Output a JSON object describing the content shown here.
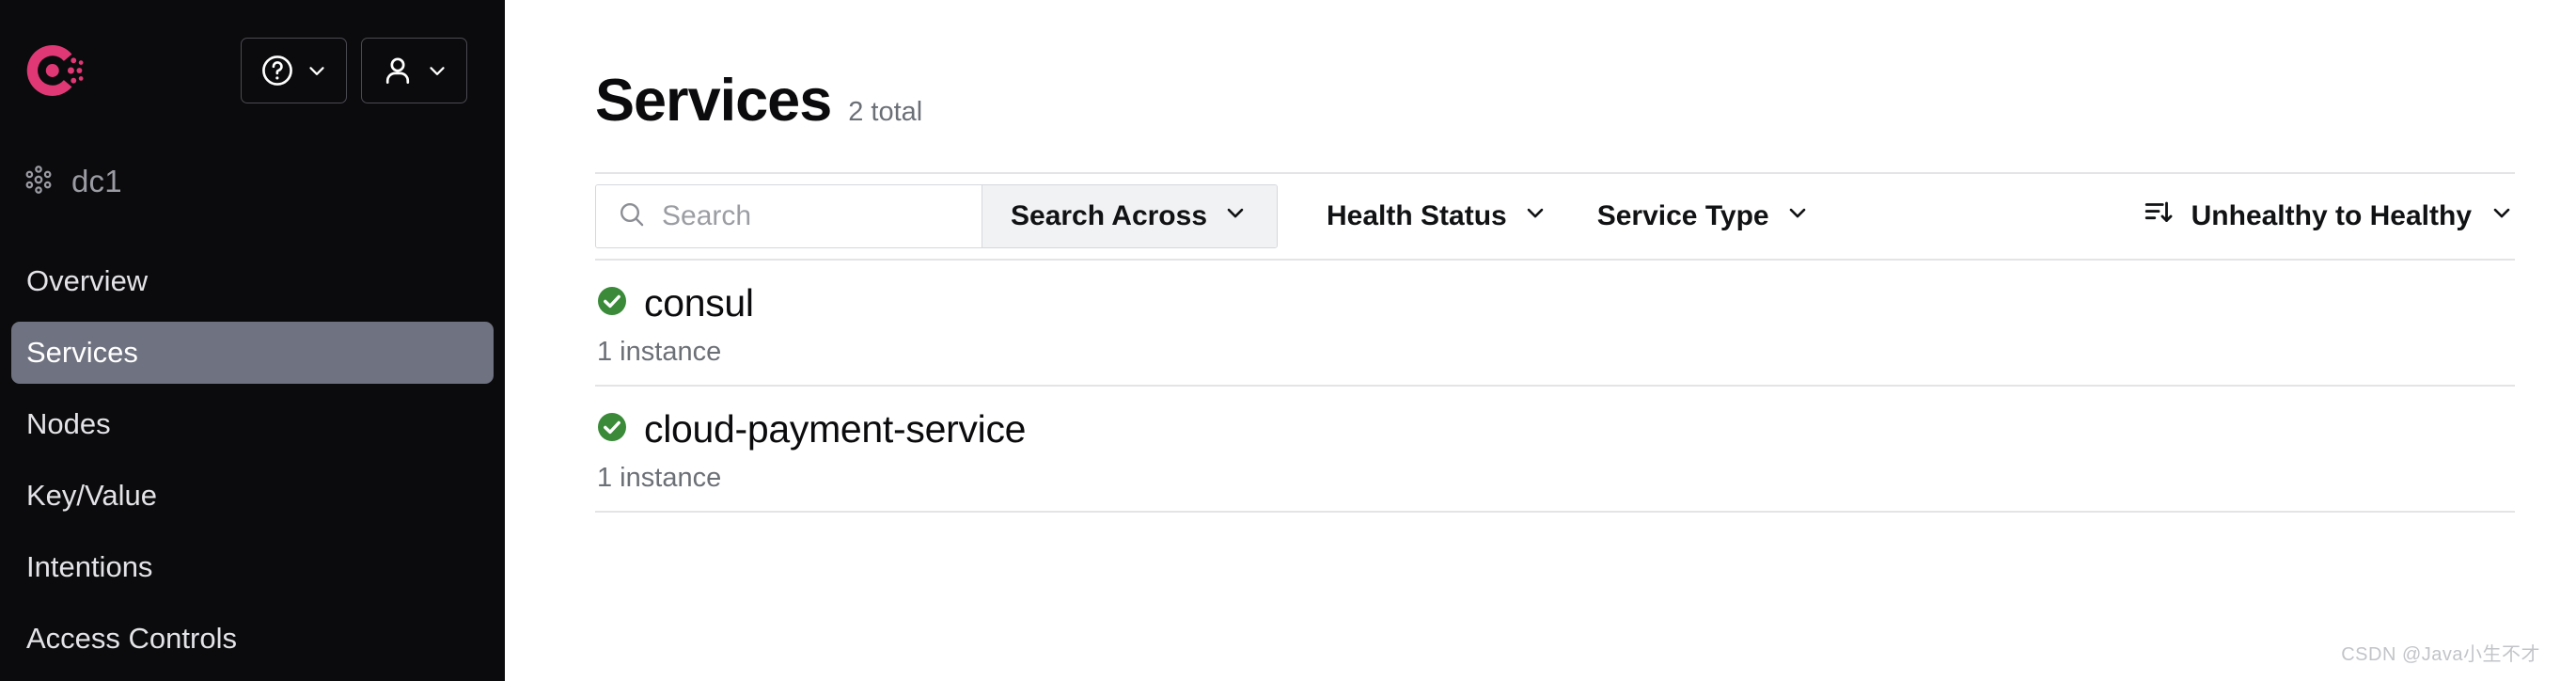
{
  "sidebar": {
    "logo_icon": "consul-logo-icon",
    "logo_color": "#e03875",
    "header_buttons": [
      {
        "icon": "help-circle-icon",
        "chevron": "chevron-down-icon"
      },
      {
        "icon": "user-icon",
        "chevron": "chevron-down-icon"
      }
    ],
    "datacenter": {
      "icon": "datacenter-nodes-icon",
      "label": "dc1"
    },
    "items": [
      {
        "label": "Overview",
        "active": false
      },
      {
        "label": "Services",
        "active": true
      },
      {
        "label": "Nodes",
        "active": false
      },
      {
        "label": "Key/Value",
        "active": false
      },
      {
        "label": "Intentions",
        "active": false
      },
      {
        "label": "Access Controls",
        "active": false
      }
    ],
    "active_bg": "#6f7280",
    "bg": "#0b0b0d"
  },
  "main": {
    "title": "Services",
    "total": "2 total",
    "filters": {
      "search_icon": "search-icon",
      "search_placeholder": "Search",
      "search_value": "",
      "search_across_label": "Search Across",
      "health_status_label": "Health Status",
      "service_type_label": "Service Type",
      "sort_icon": "sort-descending-icon",
      "sort_label": "Unhealthy to Healthy"
    },
    "services": [
      {
        "name": "consul",
        "instances": "1 instance",
        "health": "passing",
        "health_icon": "check-circle-icon"
      },
      {
        "name": "cloud-payment-service",
        "instances": "1 instance",
        "health": "passing",
        "health_icon": "check-circle-icon"
      }
    ],
    "health_color": "#3a8a3a",
    "watermark": "CSDN @Java小生不才"
  }
}
